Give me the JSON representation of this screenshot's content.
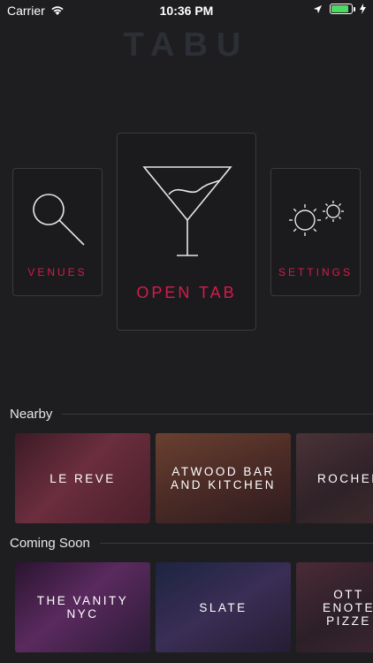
{
  "status_bar": {
    "carrier": "Carrier",
    "time": "10:36 PM",
    "battery_level": 0.85
  },
  "brand": {
    "logo": "TABU"
  },
  "main_tiles": {
    "venues": "VENUES",
    "open_tab": "OPEN TAB",
    "settings": "SETTINGS"
  },
  "nearby": {
    "title": "Nearby",
    "items": [
      {
        "label": "LE REVE",
        "color": "#5a2434"
      },
      {
        "label": "ATWOOD BAR AND KITCHEN",
        "color": "#4a2b2a"
      },
      {
        "label": "ROCHEL",
        "color": "#3f2730"
      }
    ]
  },
  "coming_soon": {
    "title": "Coming Soon",
    "items": [
      {
        "label": "THE VANITY NYC",
        "color": "#3b1f40"
      },
      {
        "label": "SLATE",
        "color": "#2b2540"
      },
      {
        "label": "OTT ENOTE PIZZE",
        "color": "#3a2330"
      }
    ]
  },
  "colors": {
    "accent": "#d81b4a",
    "background": "#1e1e20"
  }
}
